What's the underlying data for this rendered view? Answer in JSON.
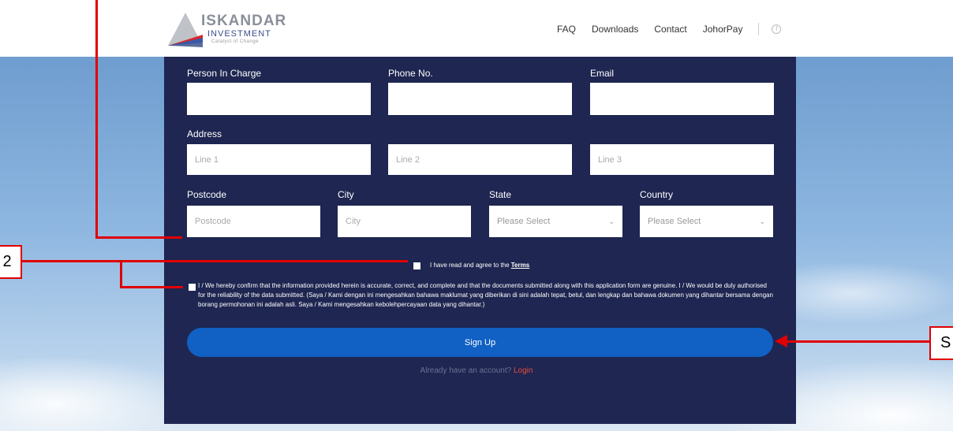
{
  "header": {
    "logo_title": "ISKANDAR",
    "logo_subtitle": "INVESTMENT",
    "logo_tagline": "Catalyst of Change",
    "nav": [
      "FAQ",
      "Downloads",
      "Contact",
      "JohorPay"
    ],
    "social_icon": "facebook-icon"
  },
  "form": {
    "labels": {
      "person": "Person In Charge",
      "phone": "Phone No.",
      "email": "Email",
      "address": "Address",
      "postcode": "Postcode",
      "city": "City",
      "state": "State",
      "country": "Country"
    },
    "placeholders": {
      "line1": "Line 1",
      "line2": "Line 2",
      "line3": "Line 3",
      "postcode": "Postcode",
      "city": "City"
    },
    "state_value": "Please Select",
    "country_value": "Please Select",
    "terms_prefix": "I have read and agree to the",
    "terms_link": "Terms",
    "confirm_text": "I / We hereby confirm that the information provided herein is accurate, correct, and complete and that the documents submitted along with this application form are genuine. I / We would be duly authorised for the reliability of the data submitted. (Saya / Kami dengan ini mengesahkan bahawa maklumat yang diberikan di sini adalah tepat, betul, dan lengkap dan bahawa dokumen yang dihantar bersama dengan borang permohonan ini adalah asli. Saya / Kami mengesahkan kebolehpercayaan data yang dihantar.)",
    "signup_label": "Sign Up",
    "already_text": "Already have an account?",
    "login_label": "Login"
  },
  "annotations": {
    "callout_left": "2",
    "callout_right": "S"
  },
  "colors": {
    "panel": "#1e2651",
    "button": "#1160c4",
    "login": "#e84c3d",
    "annotation": "#e00000"
  }
}
